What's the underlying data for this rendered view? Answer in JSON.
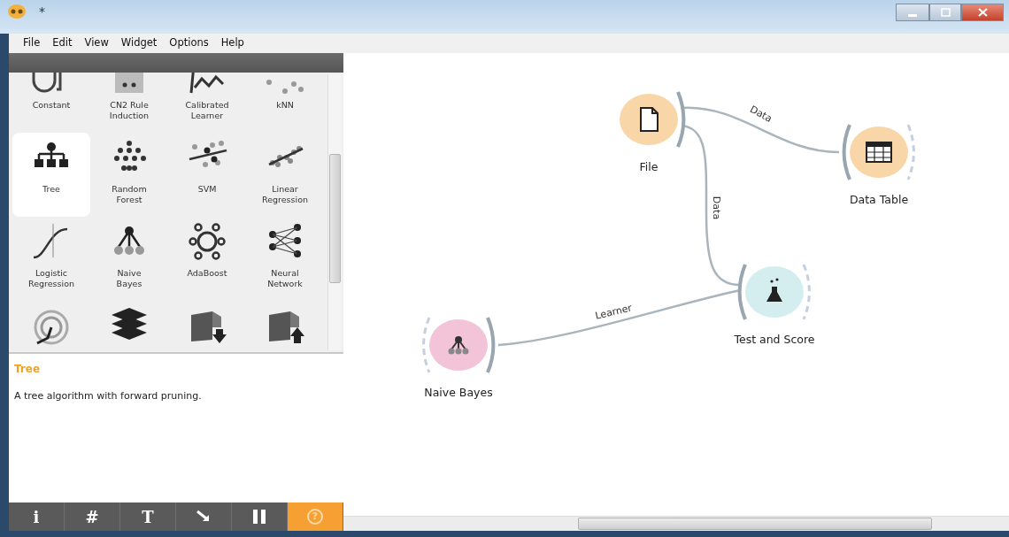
{
  "window": {
    "title": "*"
  },
  "menu": [
    "File",
    "Edit",
    "View",
    "Widget",
    "Options",
    "Help"
  ],
  "widgets": [
    {
      "label": "Constant",
      "selected": false
    },
    {
      "label": "CN2 Rule\nInduction",
      "selected": false
    },
    {
      "label": "Calibrated\nLearner",
      "selected": false
    },
    {
      "label": "kNN",
      "selected": false
    },
    {
      "label": "Tree",
      "selected": true
    },
    {
      "label": "Random\nForest",
      "selected": false
    },
    {
      "label": "SVM",
      "selected": false
    },
    {
      "label": "Linear\nRegression",
      "selected": false
    },
    {
      "label": "Logistic\nRegression",
      "selected": false
    },
    {
      "label": "Naive\nBayes",
      "selected": false
    },
    {
      "label": "AdaBoost",
      "selected": false
    },
    {
      "label": "Neural\nNetwork",
      "selected": false
    },
    {
      "selected": false
    },
    {
      "selected": false
    },
    {
      "selected": false
    },
    {
      "selected": false
    }
  ],
  "description": {
    "title": "Tree",
    "text": "A tree algorithm with forward pruning."
  },
  "toolbar": [
    {
      "kind": "text",
      "label": "i",
      "on": false
    },
    {
      "kind": "text",
      "label": "#",
      "on": false
    },
    {
      "kind": "text",
      "label": "T",
      "on": false
    },
    {
      "kind": "arrow",
      "on": false
    },
    {
      "kind": "pause",
      "on": false
    },
    {
      "kind": "help",
      "label": "?",
      "on": true
    }
  ],
  "canvas": {
    "nodes": [
      {
        "label": "File",
        "kind": "file",
        "color": "#f9d6a8"
      },
      {
        "label": "Data Table",
        "kind": "table",
        "color": "#f9d6a8"
      },
      {
        "label": "Test and Score",
        "kind": "flask",
        "color": "#d4eef0"
      },
      {
        "label": "Naive Bayes",
        "kind": "bayes",
        "color": "#f3c4d8"
      }
    ],
    "links": [
      {
        "label": "Data"
      },
      {
        "label": "Data"
      },
      {
        "label": "Learner"
      }
    ]
  }
}
